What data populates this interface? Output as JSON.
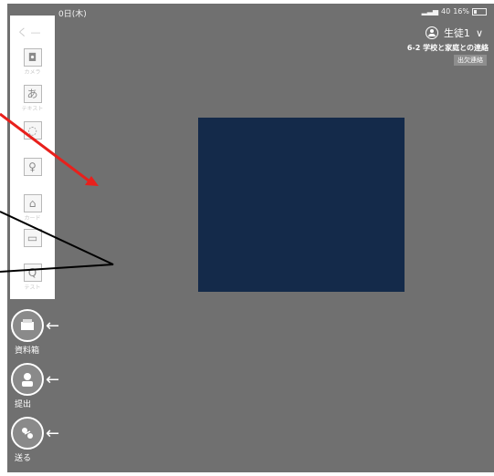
{
  "status": {
    "time": "0日(木)",
    "signal": "40",
    "battery": "16%"
  },
  "user": {
    "name": "生徒1"
  },
  "class_title": "6-2 学校と家庭との連絡",
  "attend_tag": "出欠連絡",
  "toolbar": {
    "back": "く",
    "tools": [
      {
        "name": "camera",
        "glyph": "◘",
        "label": "カメラ"
      },
      {
        "name": "text",
        "glyph": "あ",
        "label": "テキスト"
      },
      {
        "name": "web",
        "glyph": "◌",
        "label": ""
      },
      {
        "name": "pin",
        "glyph": "♀",
        "label": ""
      },
      {
        "name": "image",
        "glyph": "⌂",
        "label": "カード"
      },
      {
        "name": "video",
        "glyph": "▭",
        "label": ""
      },
      {
        "name": "q",
        "glyph": "Q",
        "label": "テスト"
      }
    ]
  },
  "side": [
    {
      "name": "materials",
      "label": "資料箱"
    },
    {
      "name": "submit",
      "label": "提出"
    },
    {
      "name": "send",
      "label": "送る"
    }
  ],
  "colors": {
    "background": "#707070",
    "canvas": "#142a4a",
    "annotation": "#e8201c"
  }
}
